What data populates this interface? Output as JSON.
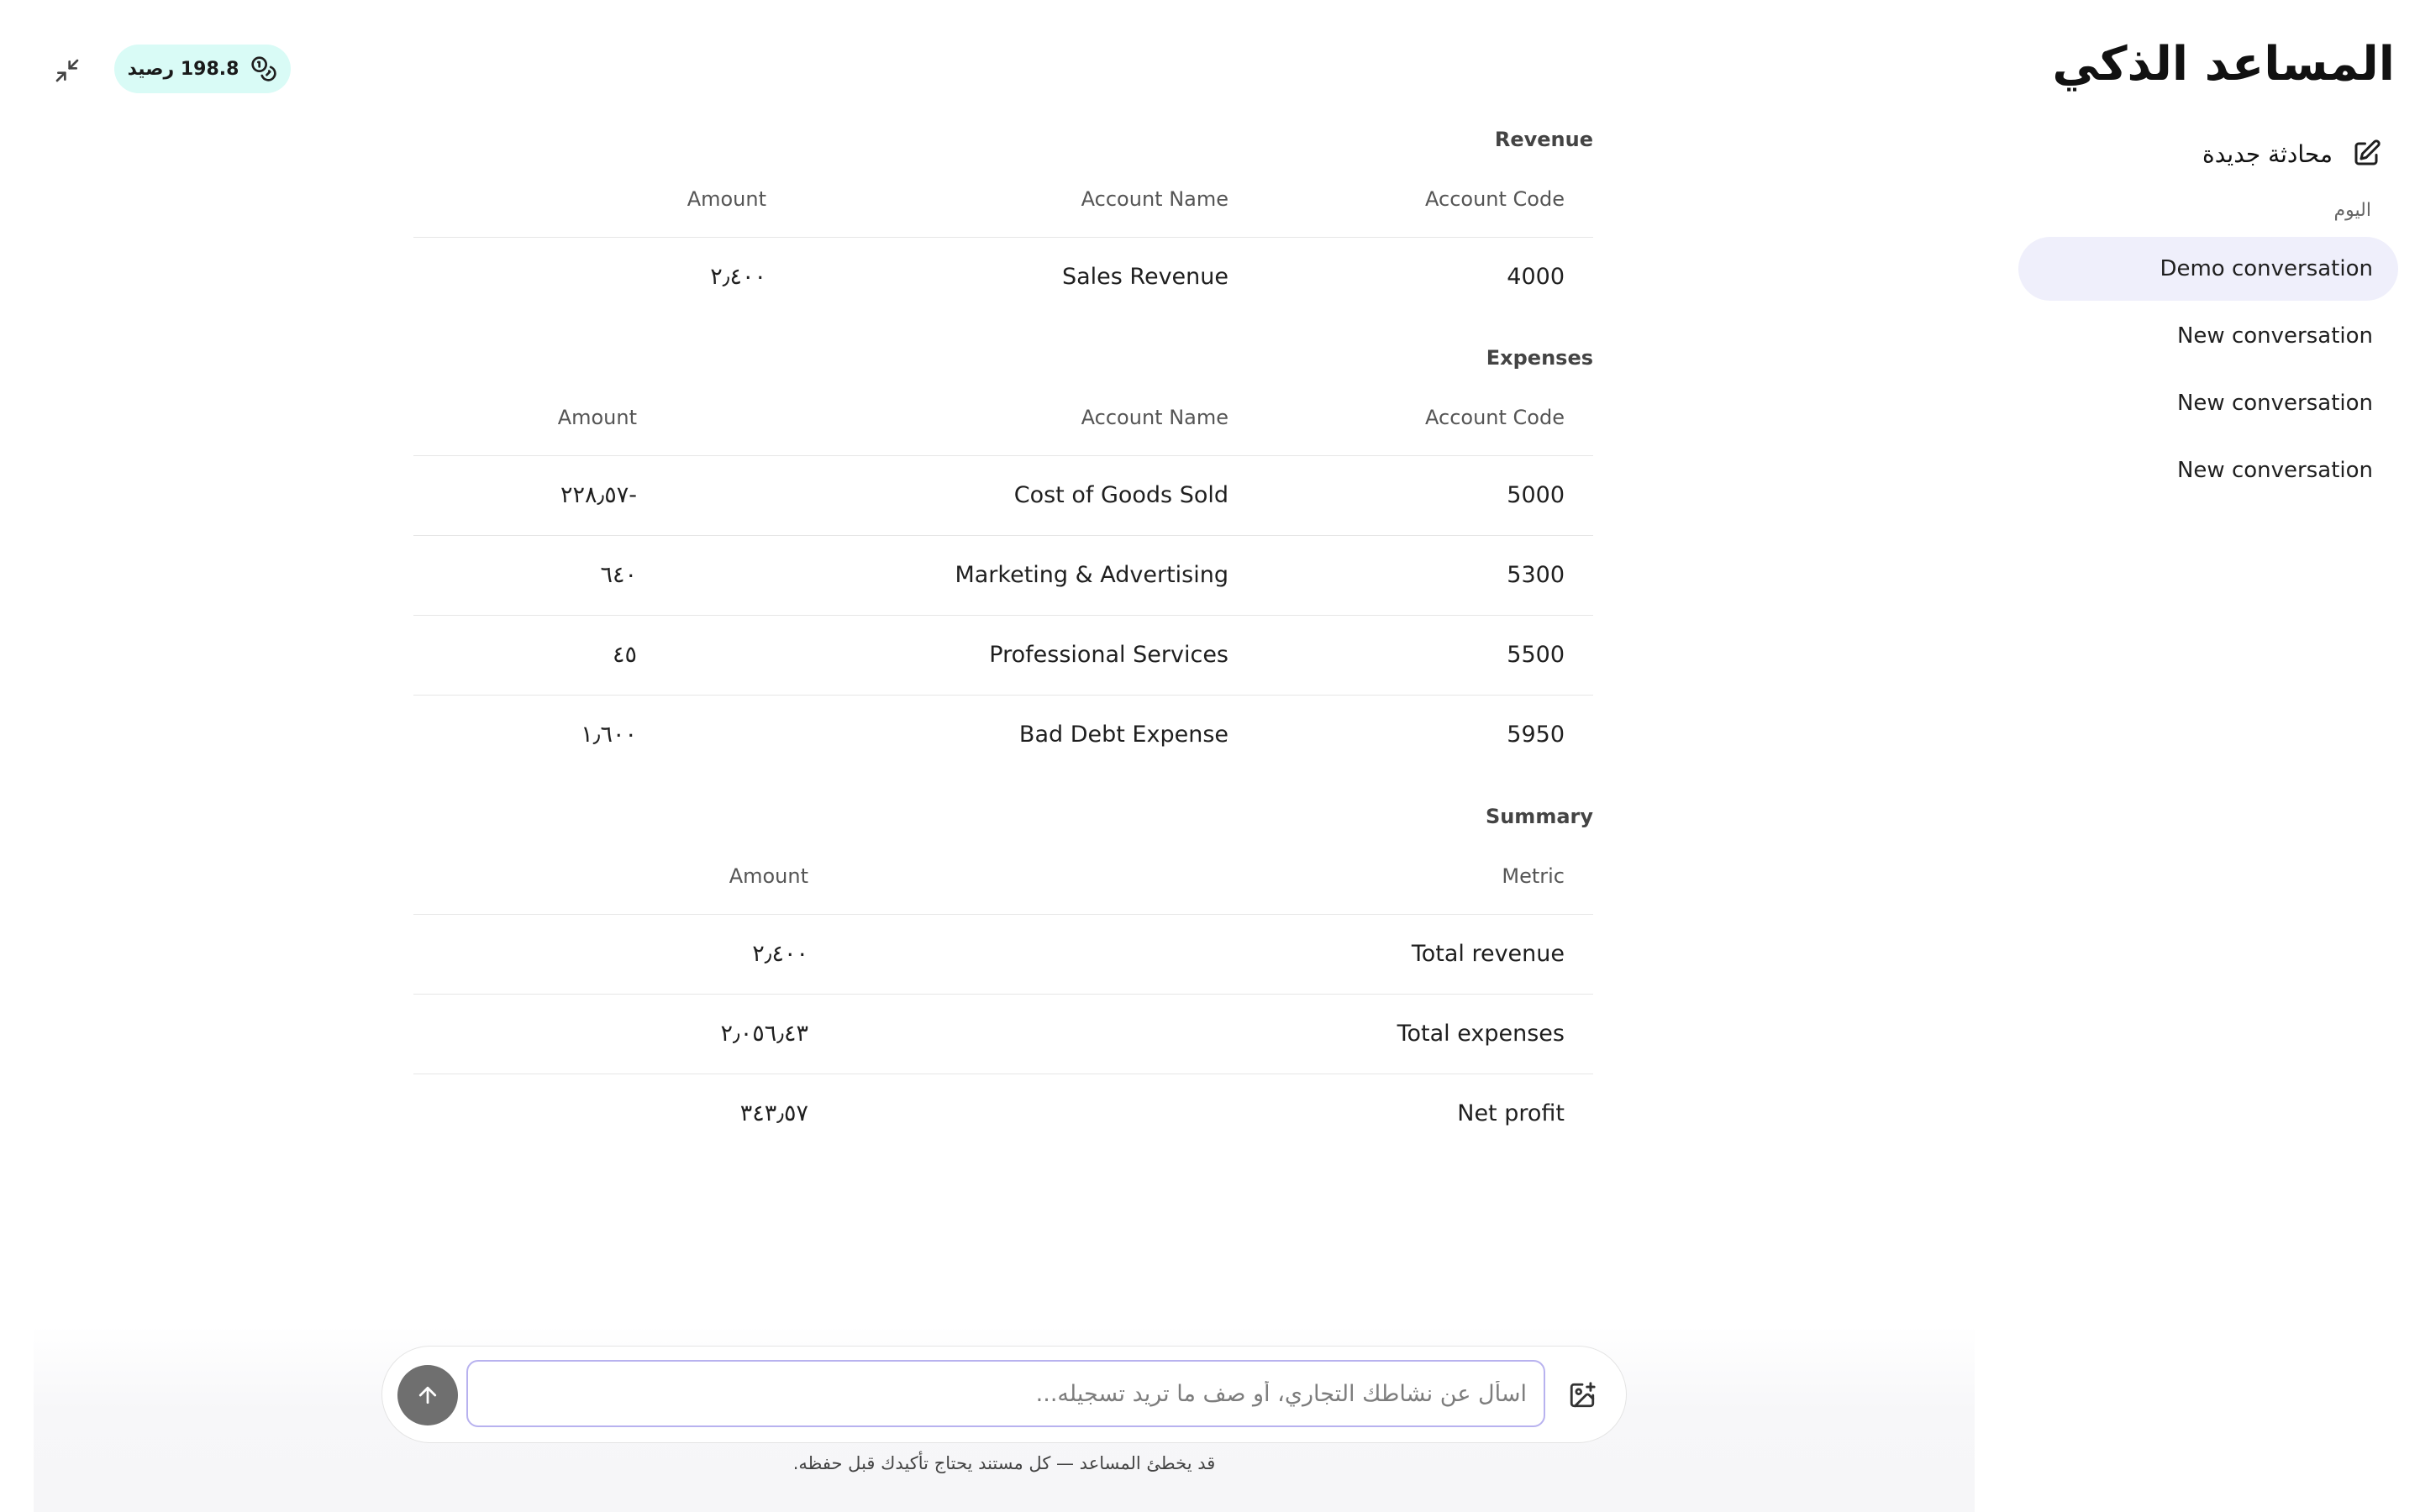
{
  "sidebar": {
    "title": "المساعد الذكي",
    "new_chat_label": "محادثة جديدة",
    "section_label": "اليوم",
    "conversations": [
      {
        "label": "Demo conversation",
        "active": true
      },
      {
        "label": "New conversation",
        "active": false
      },
      {
        "label": "New conversation",
        "active": false
      },
      {
        "label": "New conversation",
        "active": false
      }
    ]
  },
  "header": {
    "balance_label": "198.8 رصيد",
    "icons": {
      "collapse": "collapse-arrows-icon",
      "balance": "coins-icon"
    }
  },
  "revenue": {
    "title": "Revenue",
    "columns": [
      "Account Code",
      "Account Name",
      "Amount"
    ],
    "rows": [
      [
        "4000",
        "Sales Revenue",
        "٢٫٤٠٠"
      ]
    ]
  },
  "expenses": {
    "title": "Expenses",
    "columns": [
      "Account Code",
      "Account Name",
      "Amount"
    ],
    "rows": [
      [
        "5000",
        "Cost of Goods Sold",
        "-٢٢٨٫٥٧"
      ],
      [
        "5300",
        "Marketing & Advertising",
        "٦٤٠"
      ],
      [
        "5500",
        "Professional Services",
        "٤٥"
      ],
      [
        "5950",
        "Bad Debt Expense",
        "١٫٦٠٠"
      ]
    ]
  },
  "summary": {
    "title": "Summary",
    "columns": [
      "Metric",
      "Amount"
    ],
    "rows": [
      [
        "Total revenue",
        "٢٫٤٠٠"
      ],
      [
        "Total expenses",
        "٢٫٠٥٦٫٤٣"
      ],
      [
        "Net profit",
        "٣٤٣٫٥٧"
      ]
    ]
  },
  "composer": {
    "placeholder": "اسأل عن نشاطك التجاري، أو صف ما تريد تسجيله...",
    "value": "",
    "disclaimer": "قد يخطئ المساعد — كل مستند يحتاج تأكيدك قبل حفظه.",
    "icons": {
      "send": "arrow-up-icon",
      "attach": "image-plus-icon"
    }
  },
  "colors": {
    "accent_input_border": "#b8b2ef",
    "active_conversation_bg": "#efeffb",
    "balance_badge_bg": "#d9fbf6",
    "send_button_bg": "#6f6f6f"
  }
}
